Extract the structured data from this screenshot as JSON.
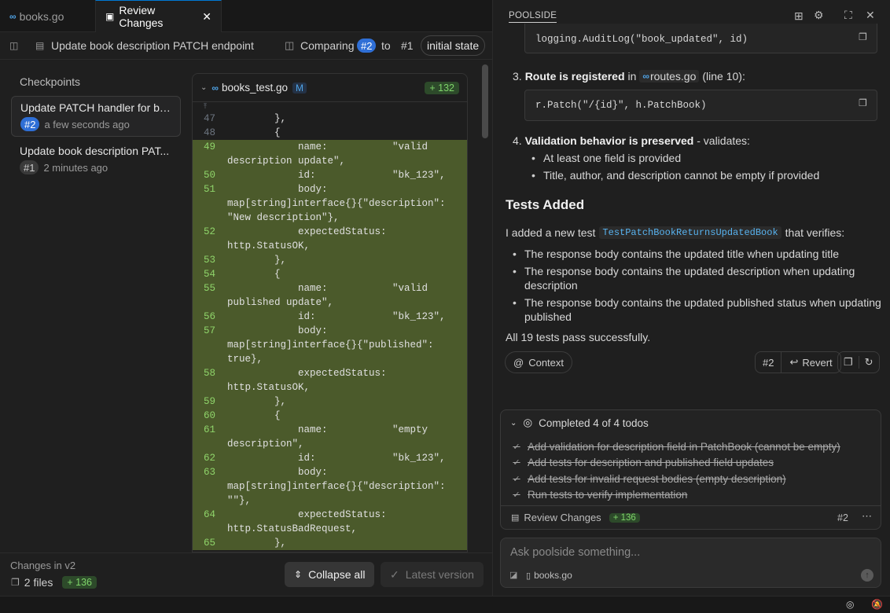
{
  "tabs": [
    {
      "label": "books.go"
    },
    {
      "label": "Review Changes"
    }
  ],
  "toolbar": {
    "title": "Update book description PATCH endpoint",
    "comparing": "Comparing",
    "from": "#2",
    "to_word": "to",
    "to": "#1",
    "state": "initial state"
  },
  "checkpoints": {
    "heading": "Checkpoints",
    "items": [
      {
        "title": "Update PATCH handler for bo...",
        "badge": "#2",
        "time": "a few seconds ago"
      },
      {
        "title": "Update book description PAT...",
        "badge": "#1",
        "time": "2 minutes ago"
      }
    ]
  },
  "diff": {
    "file": "books_test.go",
    "status": "M",
    "added": "+ 132",
    "lines": [
      {
        "n": "47",
        "t": "        },",
        "added": false
      },
      {
        "n": "48",
        "t": "        {",
        "added": false
      },
      {
        "n": "49",
        "t": "            name:           \"valid",
        "added": true
      },
      {
        "n": "",
        "t": "description update\",",
        "added": true
      },
      {
        "n": "50",
        "t": "            id:             \"bk_123\",",
        "added": true
      },
      {
        "n": "51",
        "t": "            body:",
        "added": true
      },
      {
        "n": "",
        "t": "map[string]interface{}{\"description\":",
        "added": true
      },
      {
        "n": "",
        "t": "\"New description\"},",
        "added": true
      },
      {
        "n": "52",
        "t": "            expectedStatus:",
        "added": true
      },
      {
        "n": "",
        "t": "http.StatusOK,",
        "added": true
      },
      {
        "n": "53",
        "t": "        },",
        "added": true
      },
      {
        "n": "54",
        "t": "        {",
        "added": true
      },
      {
        "n": "55",
        "t": "            name:           \"valid",
        "added": true
      },
      {
        "n": "",
        "t": "published update\",",
        "added": true
      },
      {
        "n": "56",
        "t": "            id:             \"bk_123\",",
        "added": true
      },
      {
        "n": "57",
        "t": "            body:",
        "added": true
      },
      {
        "n": "",
        "t": "map[string]interface{}{\"published\":",
        "added": true
      },
      {
        "n": "",
        "t": "true},",
        "added": true
      },
      {
        "n": "58",
        "t": "            expectedStatus:",
        "added": true
      },
      {
        "n": "",
        "t": "http.StatusOK,",
        "added": true
      },
      {
        "n": "59",
        "t": "        },",
        "added": true
      },
      {
        "n": "60",
        "t": "        {",
        "added": true
      },
      {
        "n": "61",
        "t": "            name:           \"empty",
        "added": true
      },
      {
        "n": "",
        "t": "description\",",
        "added": true
      },
      {
        "n": "62",
        "t": "            id:             \"bk_123\",",
        "added": true
      },
      {
        "n": "63",
        "t": "            body:",
        "added": true
      },
      {
        "n": "",
        "t": "map[string]interface{}{\"description\":",
        "added": true
      },
      {
        "n": "",
        "t": "\"\"},",
        "added": true
      },
      {
        "n": "64",
        "t": "            expectedStatus:",
        "added": true
      },
      {
        "n": "",
        "t": "http.StatusBadRequest,",
        "added": true
      },
      {
        "n": "65",
        "t": "        },",
        "added": true
      }
    ]
  },
  "footer": {
    "changes": "Changes in v2",
    "files": "2 files",
    "added": "+ 136",
    "collapse": "Collapse all",
    "latest": "Latest version"
  },
  "panel": {
    "title": "POOLSIDE",
    "code1": "logging.AuditLog(\"book_updated\", id)",
    "item3_num": "3.",
    "item3_a": "Route is registered",
    "item3_b": "in",
    "item3_file": "routes.go",
    "item3_c": "(line 10):",
    "code2": "r.Patch(\"/{id}\", h.PatchBook)",
    "item4_num": "4.",
    "item4_a": "Validation behavior is preserved",
    "item4_b": " - validates:",
    "item4_bullets": [
      "At least one field is provided",
      "Title, author, and description cannot be empty if provided"
    ],
    "tests_heading": "Tests Added",
    "tests_intro_a": "I added a new test",
    "tests_intro_code": "TestPatchBookReturnsUpdatedBook",
    "tests_intro_b": "that verifies:",
    "tests_bullets": [
      {
        "l1": "The response body contains the updated title when updating title",
        "l2": ""
      },
      {
        "l1": "The response body contains the updated description when updating",
        "l2": "description"
      },
      {
        "l1": "The response body contains the updated published status when updating",
        "l2": "published"
      }
    ],
    "summary": "All 19 tests pass successfully.",
    "context": "Context",
    "rev_badge": "#2",
    "revert": "Revert"
  },
  "todos": {
    "header": "Completed 4 of 4 todos",
    "items": [
      "Add validation for description field in PatchBook (cannot be empty)",
      "Add tests for description and published field updates",
      "Add tests for invalid request bodies (empty description)",
      "Run tests to verify implementation"
    ],
    "review": "Review Changes",
    "added": "+ 136",
    "badge": "#2"
  },
  "ask": {
    "placeholder": "Ask poolside something...",
    "file": "books.go"
  }
}
